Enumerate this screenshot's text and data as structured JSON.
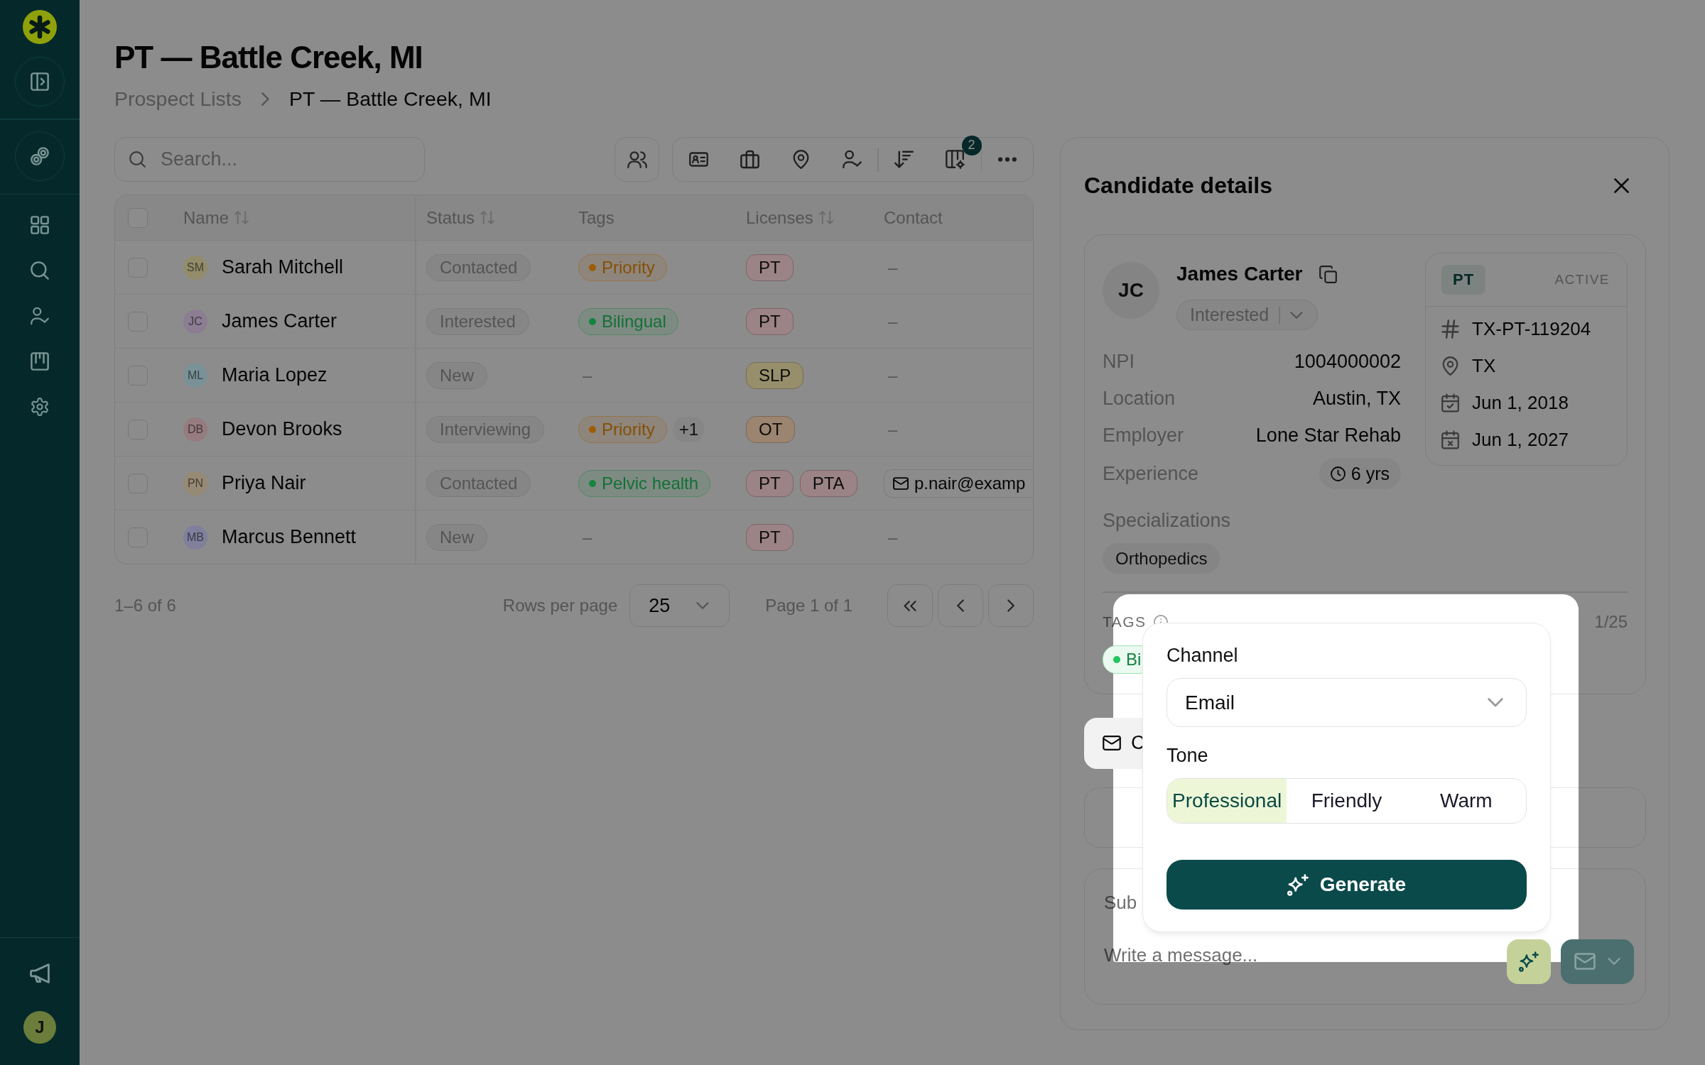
{
  "sidebar": {
    "user_initial": "J"
  },
  "header": {
    "title": "PT — Battle Creek, MI",
    "breadcrumb": [
      {
        "label": "Prospect Lists",
        "current": false
      },
      {
        "label": "PT — Battle Creek, MI",
        "current": true
      }
    ]
  },
  "toolbar": {
    "search": {
      "placeholder": "Search..."
    },
    "columns_badge": "2"
  },
  "table": {
    "all_checked": false,
    "columns": [
      {
        "label": "Name",
        "sortable": true
      },
      {
        "label": "Status",
        "sortable": true
      },
      {
        "label": "Tags",
        "sortable": false
      },
      {
        "label": "Licenses",
        "sortable": true
      },
      {
        "label": "Contact",
        "sortable": false
      }
    ],
    "rows": [
      {
        "checked": false,
        "avatar": {
          "initials": "SM",
          "color": "#938c6b"
        },
        "name": "Sarah Mitchell",
        "status": "Contacted",
        "tags": [
          {
            "label": "Priority",
            "color": "#9c5d07"
          }
        ],
        "licenses": [
          {
            "label": "PT",
            "color": "#9c8386"
          }
        ],
        "contact": {
          "kind": "none",
          "text": "–"
        }
      },
      {
        "checked": false,
        "avatar": {
          "initials": "JC",
          "color": "#8c7d92"
        },
        "name": "James Carter",
        "status": "Interested",
        "tags": [
          {
            "label": "Bilingual",
            "color": "#15843f"
          }
        ],
        "licenses": [
          {
            "label": "PT",
            "color": "#9c8386"
          }
        ],
        "contact": {
          "kind": "none",
          "text": "–"
        }
      },
      {
        "checked": false,
        "avatar": {
          "initials": "ML",
          "color": "#7a9297"
        },
        "name": "Maria Lopez",
        "status": "New",
        "tags_empty": "–",
        "licenses": [
          {
            "label": "SLP",
            "color": "#978f6c"
          }
        ],
        "contact": {
          "kind": "none",
          "text": "–"
        }
      },
      {
        "checked": false,
        "avatar": {
          "initials": "DB",
          "color": "#967b80"
        },
        "name": "Devon Brooks",
        "status": "Interviewing",
        "tags": [
          {
            "label": "Priority",
            "color": "#9c5d07"
          }
        ],
        "tags_more": "+1",
        "licenses": [
          {
            "label": "OT",
            "color": "#9c8570"
          }
        ],
        "contact": {
          "kind": "none",
          "text": "–"
        }
      },
      {
        "checked": false,
        "avatar": {
          "initials": "PN",
          "color": "#978a74"
        },
        "name": "Priya Nair",
        "status": "Contacted",
        "tags": [
          {
            "label": "Pelvic health",
            "color": "#15843f"
          }
        ],
        "licenses": [
          {
            "label": "PT",
            "color": "#9c8386"
          },
          {
            "label": "PTA",
            "color": "#9c8386"
          }
        ],
        "contact": {
          "kind": "email",
          "text": "p.nair@examp"
        }
      },
      {
        "checked": false,
        "avatar": {
          "initials": "MB",
          "color": "#807f9c"
        },
        "name": "Marcus Bennett",
        "status": "New",
        "tags_empty": "–",
        "licenses": [
          {
            "label": "PT",
            "color": "#9c8386"
          }
        ],
        "contact": {
          "kind": "none",
          "text": "–"
        }
      }
    ]
  },
  "pagination": {
    "range": "1–6 of 6",
    "rows_per_page_label": "Rows per page",
    "rows_per_page": "25",
    "page_label": "Page 1 of 1"
  },
  "candidate_panel": {
    "title": "Candidate details",
    "candidate": {
      "initials": "JC",
      "name": "James Carter",
      "status": "Interested",
      "fields": [
        {
          "kind": "text",
          "label": "NPI",
          "value": "1004000002"
        },
        {
          "kind": "text",
          "label": "Location",
          "value": "Austin, TX"
        },
        {
          "kind": "text",
          "label": "Employer",
          "value": "Lone Star Rehab"
        },
        {
          "kind": "duration",
          "label": "Experience",
          "value": "6 yrs"
        }
      ],
      "license": {
        "type": "PT",
        "status": "ACTIVE",
        "details": [
          {
            "kind": "number",
            "text": "TX-PT-119204"
          },
          {
            "kind": "state",
            "text": "TX"
          },
          {
            "kind": "issued",
            "text": "Jun 1, 2018"
          },
          {
            "kind": "expires",
            "text": "Jun 1, 2027"
          }
        ]
      },
      "specializations_label": "Specializations",
      "specializations": [
        "Orthopedics"
      ],
      "tags_label": "TAGS",
      "tags_count": "1/25",
      "tags": [
        {
          "label": "Bi",
          "color": "#22c55e"
        }
      ]
    },
    "composer": {
      "channel_tab": "C",
      "subject": {
        "placeholder": "Sub"
      },
      "message": {
        "placeholder": "Write a message..."
      }
    }
  },
  "outreach_popover": {
    "channel_label": "Channel",
    "channel": "Email",
    "tone_label": "Tone",
    "tones": [
      {
        "label": "Professional",
        "selected": true
      },
      {
        "label": "Friendly",
        "selected": false
      },
      {
        "label": "Warm",
        "selected": false
      }
    ],
    "generate_label": "Generate"
  }
}
